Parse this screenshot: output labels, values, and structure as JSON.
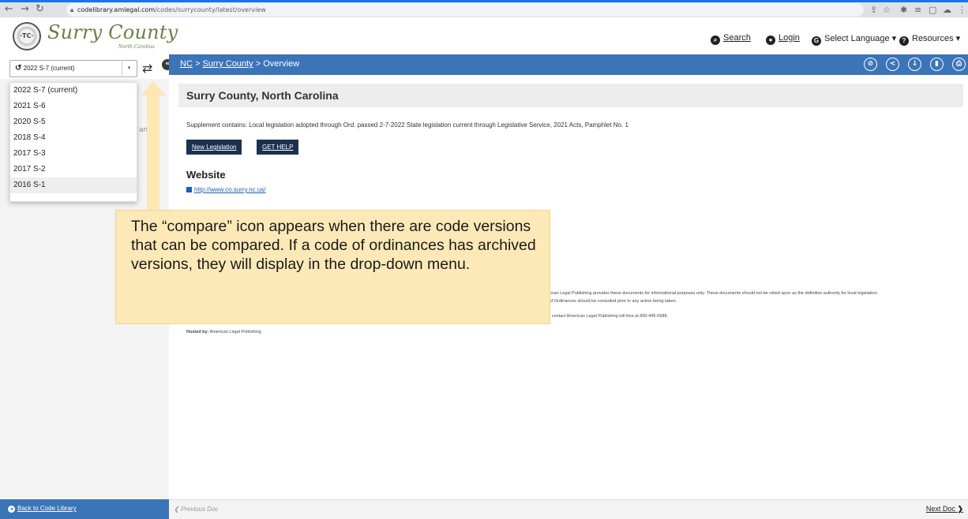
{
  "browser": {
    "url_host": "codelibrary.amlegal.com",
    "url_path": "/codes/surrycounty/latest/overview"
  },
  "header": {
    "brand_title": "Surry County",
    "brand_subtitle": "North Carolina",
    "links": {
      "search": "Search",
      "login": "Login",
      "language": "Select Language",
      "resources": "Resources"
    }
  },
  "version": {
    "selected": "2022 S-7 (current)",
    "options": [
      "2022 S-7 (current)",
      "2021 S-6",
      "2020 S-5",
      "2018 S-4",
      "2017 S-3",
      "2017 S-2",
      "2016 S-1"
    ],
    "left_stub": "an"
  },
  "breadcrumb": {
    "root": "NC",
    "sep1": " > ",
    "county": "Surry County",
    "sep2": " > ",
    "current": "Overview"
  },
  "main": {
    "title": "Surry County, North Carolina",
    "supplement": "Supplement contains: Local legislation adopted through Ord. passed 2-7-2022 State legislation current through Legislative Service, 2021 Acts, Pamphlet No. 1",
    "buttons": {
      "new_legislation": "New Legislation",
      "get_help": "GET HELP"
    },
    "website_heading": "Website",
    "website_url": "http://www.co.surry.nc.us/",
    "disclaimer_1": "merican Legal Publishing provides these documents for informational purposes only. These documents should not be relied upon as the definitive authority for local legislation.",
    "disclaimer_2": "de of Ordinances should be consulted prior to any action being taken.",
    "disclaimer_3": "y or contact American Legal Publishing toll-free at 800-445-5588.",
    "hosted_label": "Hosted by:",
    "hosted_value": " American Legal Publishing"
  },
  "callout": {
    "text": "The “compare” icon appears when there are code versions that can be compared.  If a code of ordinances has archived versions, they will display in the drop-down menu."
  },
  "footer": {
    "back": "Back to Code Library",
    "prev": "Previous Doc",
    "next": "Next Doc"
  },
  "colors": {
    "brand_green": "#6c7f47",
    "bar_blue": "#3c74b8",
    "button_navy": "#1d3050",
    "callout_bg": "#fde9b8"
  }
}
